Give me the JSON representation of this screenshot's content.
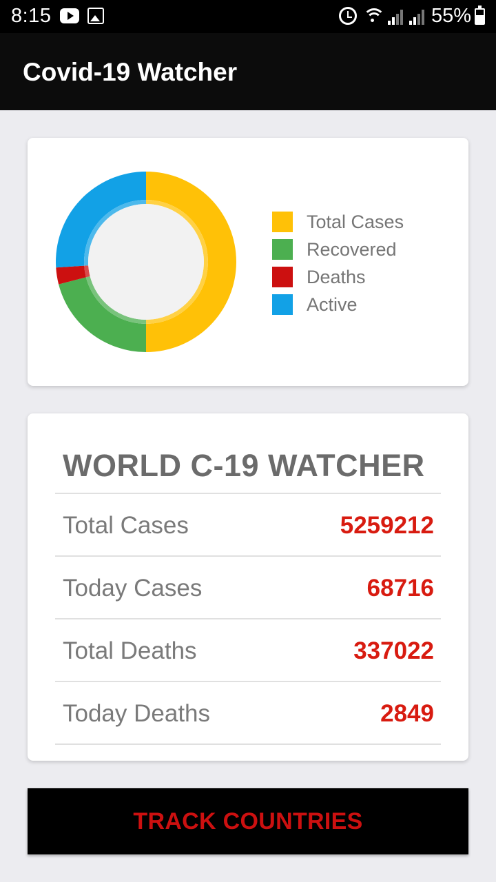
{
  "status_bar": {
    "time": "8:15",
    "battery": "55%",
    "icons": [
      "youtube-icon",
      "image-icon",
      "alarm-icon",
      "wifi-icon",
      "signal-icon",
      "signal-icon",
      "battery-icon"
    ]
  },
  "app_bar": {
    "title": "Covid-19 Watcher"
  },
  "chart_data": {
    "type": "pie",
    "categories": [
      "Total Cases",
      "Recovered",
      "Deaths",
      "Active"
    ],
    "values": [
      50,
      21,
      3,
      26
    ],
    "colors": [
      "#ffc107",
      "#4caf50",
      "#cc1010",
      "#12a1e6"
    ],
    "legend_position": "right"
  },
  "stats": {
    "title": "WORLD C-19 WATCHER",
    "rows": [
      {
        "label": " Total Cases",
        "value": "5259212"
      },
      {
        "label": "Today Cases",
        "value": "68716"
      },
      {
        "label": "Total Deaths",
        "value": "337022"
      },
      {
        "label": "Today Deaths",
        "value": "2849"
      }
    ]
  },
  "track_button": {
    "label": "TRACK COUNTRIES"
  },
  "colors": {
    "value_red": "#d81b10",
    "app_bar": "#0c0c0c",
    "background": "#ececf0"
  }
}
